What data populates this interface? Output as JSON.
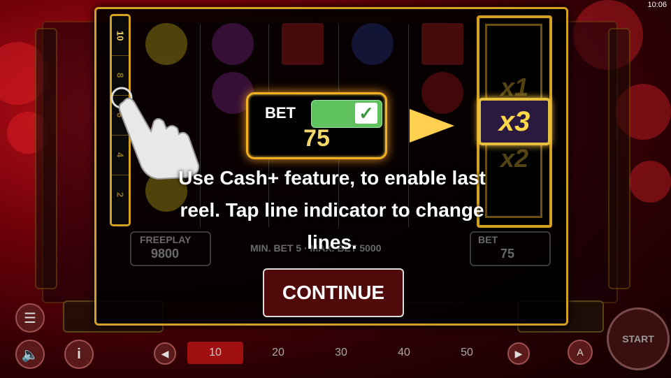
{
  "status": {
    "clock": "10:06"
  },
  "dialog": {
    "line_indicator": [
      "10",
      "8",
      "6",
      "4",
      "2"
    ],
    "bet_card": {
      "label": "BET",
      "value": "75"
    },
    "multipliers": {
      "top": "x1",
      "active": "x3",
      "bottom": "x2"
    },
    "instructions": "Use Cash+ feature, to enable last reel. Tap line indicator to change lines.",
    "freeplay_label": "FREEPLAY",
    "freeplay_value": "9800",
    "limits_text": "MIN. BET 5 · MAX. BET 5000",
    "bet_mini_label": "BET",
    "bet_mini_value": "75",
    "continue_label": "CONTINUE"
  },
  "bottom_bar": {
    "lines": [
      "10",
      "20",
      "30",
      "40",
      "50"
    ],
    "active_line": "10",
    "start_label": "START"
  },
  "icons": [
    "hand-pointer-icon",
    "arrow-right-icon",
    "menu-icon",
    "sound-icon",
    "info-icon",
    "prev-icon",
    "next-icon",
    "autoplay-icon",
    "start-icon",
    "checkmark-icon"
  ]
}
